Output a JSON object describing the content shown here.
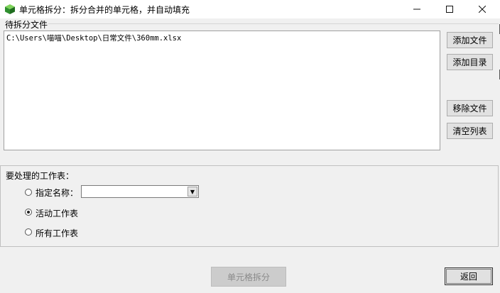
{
  "window": {
    "title": "单元格拆分：拆分合并的单元格，并自动填充",
    "icon": "green-cube-icon",
    "controls": {
      "minimize": "—",
      "maximize": "☐",
      "close": "✕"
    }
  },
  "files_group": {
    "label": "待拆分文件",
    "items": [
      "C:\\Users\\喵喵\\Desktop\\日常文件\\360mm.xlsx"
    ],
    "buttons": {
      "add_file": "添加文件",
      "add_dir": "添加目录",
      "remove_file": "移除文件",
      "clear_list": "清空列表"
    }
  },
  "sheets": {
    "title": "要处理的工作表：",
    "options": [
      {
        "label": "指定名称：",
        "checked": false
      },
      {
        "label": "活动工作表",
        "checked": true
      },
      {
        "label": "所有工作表",
        "checked": false
      }
    ],
    "select_value": ""
  },
  "actions": {
    "split": "单元格拆分",
    "split_enabled": false,
    "back": "返回"
  }
}
